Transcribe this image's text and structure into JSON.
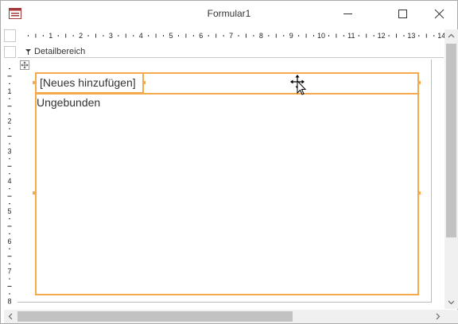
{
  "window": {
    "title": "Formular1",
    "icon": "form-icon",
    "controls": [
      "minimize-icon",
      "maximize-icon",
      "close-icon"
    ]
  },
  "ruler": {
    "h_labels": [
      "1",
      "2",
      "3",
      "4",
      "5",
      "6",
      "7",
      "8",
      "9",
      "10",
      "11",
      "12",
      "13",
      "14"
    ],
    "v_labels": [
      "1",
      "2",
      "3",
      "4",
      "5",
      "6",
      "7",
      "8"
    ]
  },
  "section": {
    "label": "Detailbereich",
    "icon": "collapse-arrow-icon"
  },
  "form": {
    "new_item_label": "[Neues hinzufügen]",
    "unbound_label": "Ungebunden"
  },
  "colors": {
    "selection": "#f5a94a",
    "scrollbar_thumb": "#c2c2c2"
  }
}
